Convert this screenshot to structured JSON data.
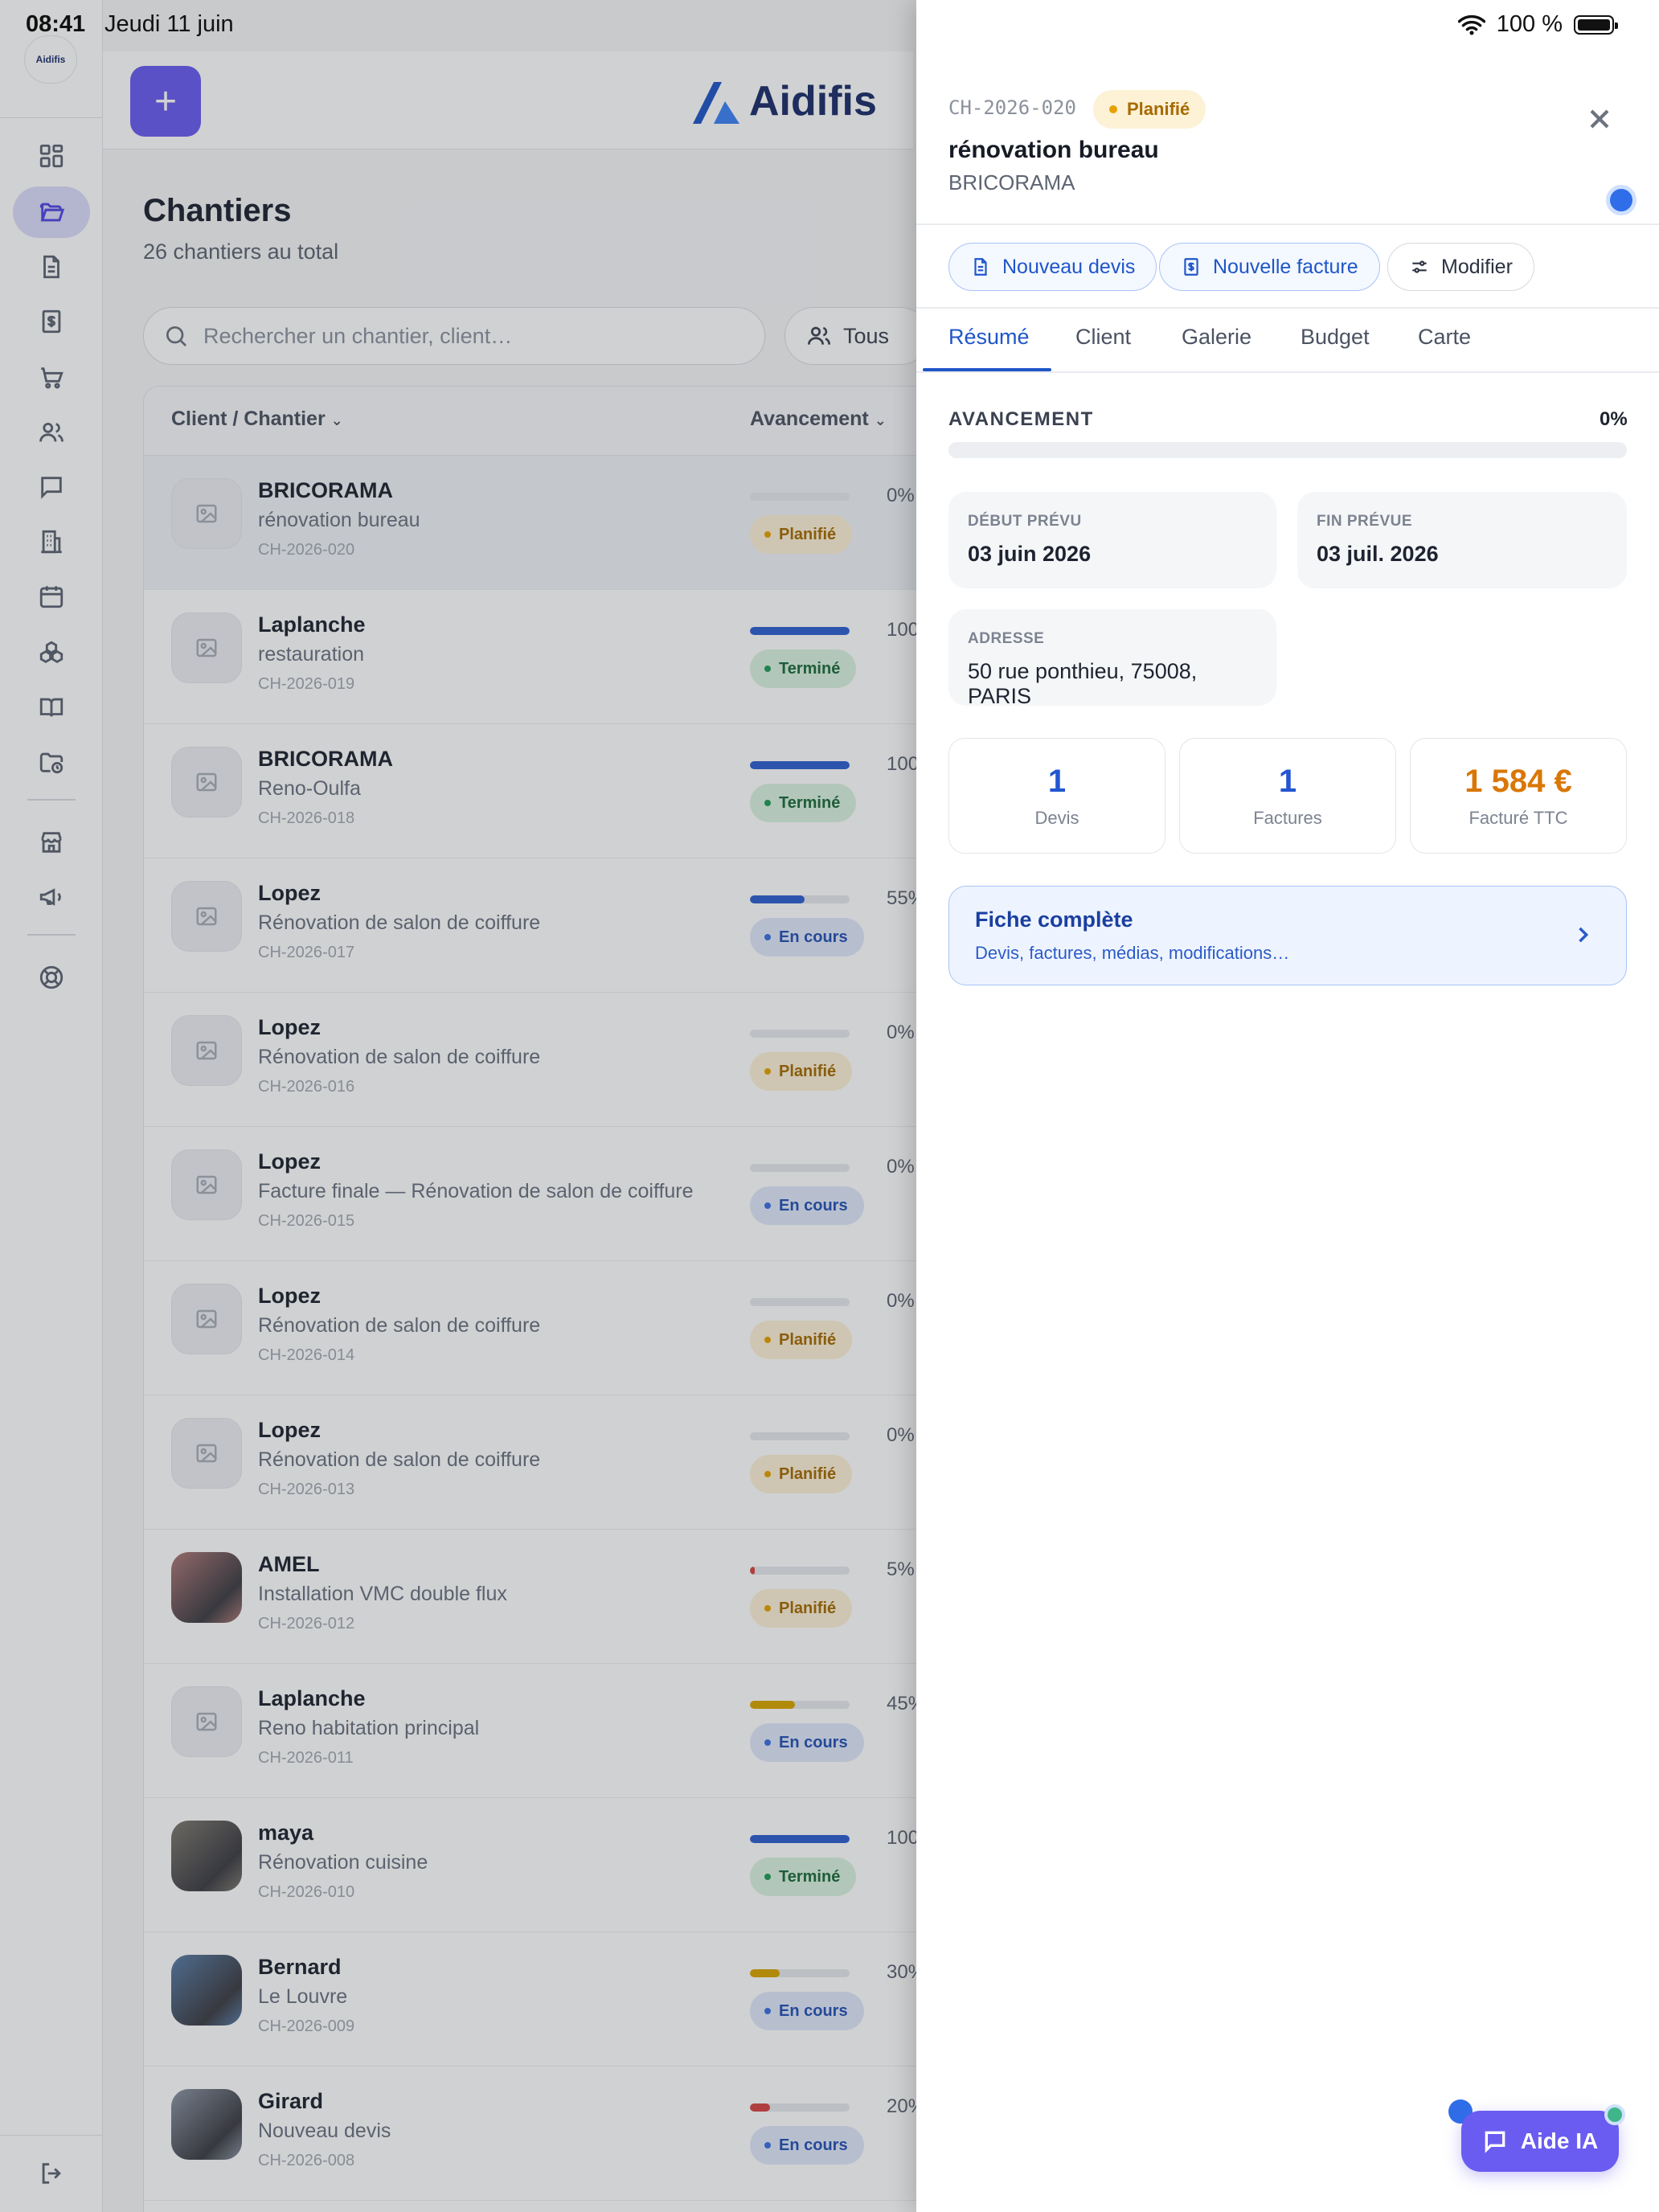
{
  "status_bar": {
    "time": "08:41",
    "date": "Jeudi 11 juin",
    "battery": "100 %"
  },
  "sidebar": {
    "logo_text": "Aidifis"
  },
  "header": {
    "brand": "Aidifis",
    "add_label": "+"
  },
  "list": {
    "title": "Chantiers",
    "subtitle": "26 chantiers au total",
    "search_placeholder": "Rechercher un chantier, client…",
    "filter_label": "Tous",
    "col_client": "Client / Chantier",
    "col_progress": "Avancement",
    "rows": [
      {
        "client": "BRICORAMA",
        "project": "rénovation bureau",
        "ref": "CH-2026-020",
        "pct": "0%",
        "progress": 0,
        "status": "Planifié",
        "kind": "plan",
        "bar_color": "#3a6fe0",
        "photo": false
      },
      {
        "client": "Laplanche",
        "project": "restauration",
        "ref": "CH-2026-019",
        "pct": "100%",
        "progress": 100,
        "status": "Terminé",
        "kind": "done",
        "bar_color": "#2f5fd0",
        "photo": false
      },
      {
        "client": "BRICORAMA",
        "project": "Reno-Oulfa",
        "ref": "CH-2026-018",
        "pct": "100%",
        "progress": 100,
        "status": "Terminé",
        "kind": "done",
        "bar_color": "#2f5fd0",
        "photo": false
      },
      {
        "client": "Lopez",
        "project": "Rénovation de salon de coiffure",
        "ref": "CH-2026-017",
        "pct": "55%",
        "progress": 55,
        "status": "En cours",
        "kind": "prog",
        "bar_color": "#2f5fd0",
        "photo": false
      },
      {
        "client": "Lopez",
        "project": "Rénovation de salon de coiffure",
        "ref": "CH-2026-016",
        "pct": "0%",
        "progress": 0,
        "status": "Planifié",
        "kind": "plan",
        "bar_color": "#3a6fe0",
        "photo": false
      },
      {
        "client": "Lopez",
        "project": "Facture finale — Rénovation de salon de coiffure",
        "ref": "CH-2026-015",
        "pct": "0%",
        "progress": 0,
        "status": "En cours",
        "kind": "prog",
        "bar_color": "#3a6fe0",
        "photo": false
      },
      {
        "client": "Lopez",
        "project": "Rénovation de salon de coiffure",
        "ref": "CH-2026-014",
        "pct": "0%",
        "progress": 0,
        "status": "Planifié",
        "kind": "plan",
        "bar_color": "#3a6fe0",
        "photo": false
      },
      {
        "client": "Lopez",
        "project": "Rénovation de salon de coiffure",
        "ref": "CH-2026-013",
        "pct": "0%",
        "progress": 0,
        "status": "Planifié",
        "kind": "plan",
        "bar_color": "#3a6fe0",
        "photo": false
      },
      {
        "client": "AMEL",
        "project": "Installation VMC double flux",
        "ref": "CH-2026-012",
        "pct": "5%",
        "progress": 5,
        "status": "Planifié",
        "kind": "plan",
        "bar_color": "#d64545",
        "photo": true,
        "photo_color": "#b07a78"
      },
      {
        "client": "Laplanche",
        "project": "Reno habitation principal",
        "ref": "CH-2026-011",
        "pct": "45%",
        "progress": 45,
        "status": "En cours",
        "kind": "prog",
        "bar_color": "#d9a400",
        "photo": false
      },
      {
        "client": "maya",
        "project": "Rénovation cuisine",
        "ref": "CH-2026-010",
        "pct": "100%",
        "progress": 100,
        "status": "Terminé",
        "kind": "done",
        "bar_color": "#2f5fd0",
        "photo": true,
        "photo_color": "#7f7a70"
      },
      {
        "client": "Bernard",
        "project": "Le Louvre",
        "ref": "CH-2026-009",
        "pct": "30%",
        "progress": 30,
        "status": "En cours",
        "kind": "prog",
        "bar_color": "#d9a400",
        "photo": true,
        "photo_color": "#5a7ea8"
      },
      {
        "client": "Girard",
        "project": "Nouveau devis",
        "ref": "CH-2026-008",
        "pct": "20%",
        "progress": 20,
        "status": "En cours",
        "kind": "prog",
        "bar_color": "#d64545",
        "photo": true,
        "photo_color": "#8c97a6"
      }
    ]
  },
  "drawer": {
    "ref": "CH-2026-020",
    "status": "Planifié",
    "title": "rénovation bureau",
    "client": "BRICORAMA",
    "actions": {
      "new_quote": "Nouveau devis",
      "new_invoice": "Nouvelle facture",
      "edit": "Modifier"
    },
    "tabs": [
      "Résumé",
      "Client",
      "Galerie",
      "Budget",
      "Carte"
    ],
    "progress_label": "AVANCEMENT",
    "progress_pct": "0%",
    "progress": 0,
    "start_label": "DÉBUT PRÉVU",
    "start_value": "03 juin 2026",
    "end_label": "FIN PRÉVUE",
    "end_value": "03 juil. 2026",
    "address_label": "ADRESSE",
    "address_value": "50 rue ponthieu, 75008, PARIS",
    "stats": [
      {
        "value": "1",
        "caption": "Devis"
      },
      {
        "value": "1",
        "caption": "Factures"
      },
      {
        "value": "1 584 €",
        "caption": "Facturé TTC"
      }
    ],
    "fiche_title": "Fiche complète",
    "fiche_sub": "Devis, factures, médias, modifications…"
  },
  "assistant": {
    "label": "Aide IA"
  },
  "colors": {
    "accent": "#6a5cf0",
    "primary_blue": "#1f56c8",
    "planned": "#e5a100",
    "done": "#1f9d55",
    "in_progress": "#3a6fe0"
  }
}
